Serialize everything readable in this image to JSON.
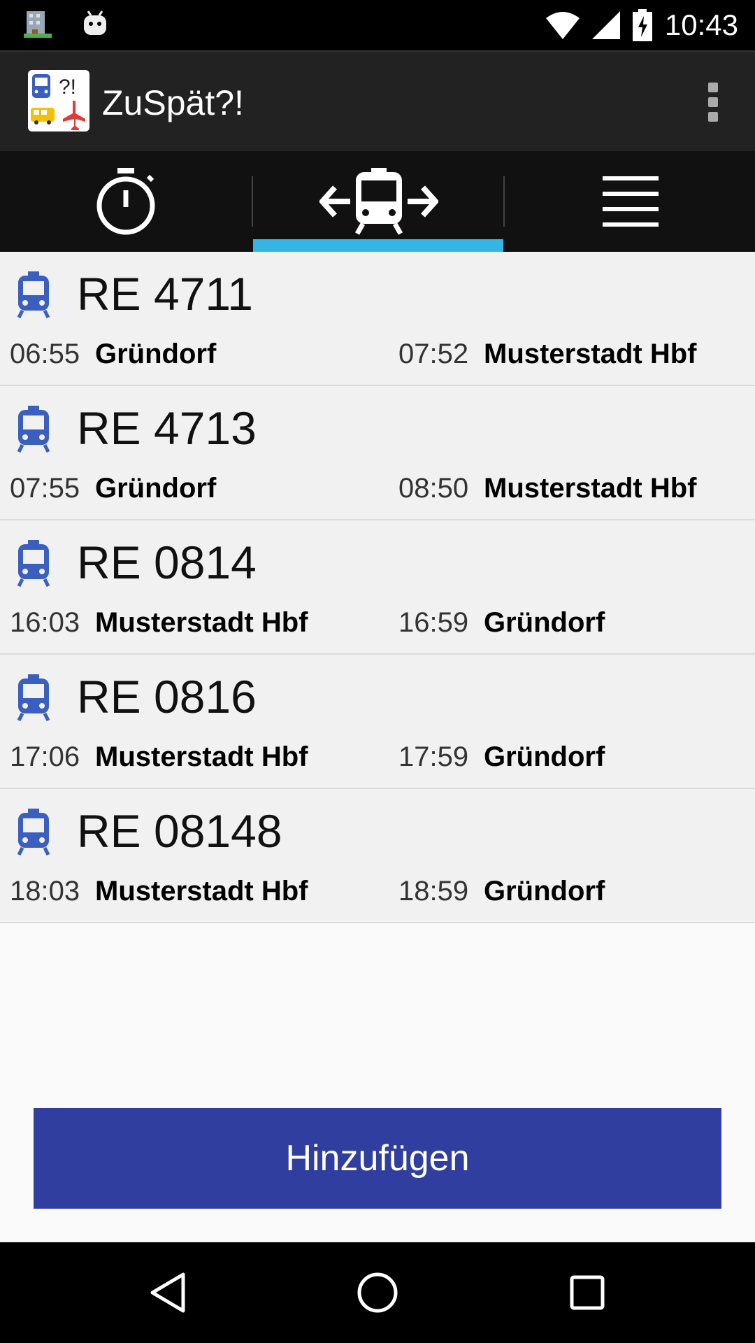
{
  "status_bar": {
    "time": "10:43"
  },
  "app": {
    "title": "ZuSpät?!",
    "logo_text": "?!"
  },
  "tabs": [
    {
      "name": "timer",
      "icon": "stopwatch-icon"
    },
    {
      "name": "trains",
      "icon": "train-arrows-icon",
      "selected": true
    },
    {
      "name": "list",
      "icon": "menu-lines-icon"
    }
  ],
  "trains": [
    {
      "name": "RE 4711",
      "dep_time": "06:55",
      "dep_station": "Gründorf",
      "arr_time": "07:52",
      "arr_station": "Musterstadt Hbf"
    },
    {
      "name": "RE 4713",
      "dep_time": "07:55",
      "dep_station": "Gründorf",
      "arr_time": "08:50",
      "arr_station": "Musterstadt Hbf"
    },
    {
      "name": "RE 0814",
      "dep_time": "16:03",
      "dep_station": "Musterstadt Hbf",
      "arr_time": "16:59",
      "arr_station": "Gründorf"
    },
    {
      "name": "RE 0816",
      "dep_time": "17:06",
      "dep_station": "Musterstadt Hbf",
      "arr_time": "17:59",
      "arr_station": "Gründorf"
    },
    {
      "name": "RE 08148",
      "dep_time": "18:03",
      "dep_station": "Musterstadt Hbf",
      "arr_time": "18:59",
      "arr_station": "Gründorf"
    }
  ],
  "add_button": {
    "label": "Hinzufügen"
  },
  "colors": {
    "accent": "#33b5e5",
    "button": "#303f9f",
    "train_icon": "#3a5fbf"
  }
}
